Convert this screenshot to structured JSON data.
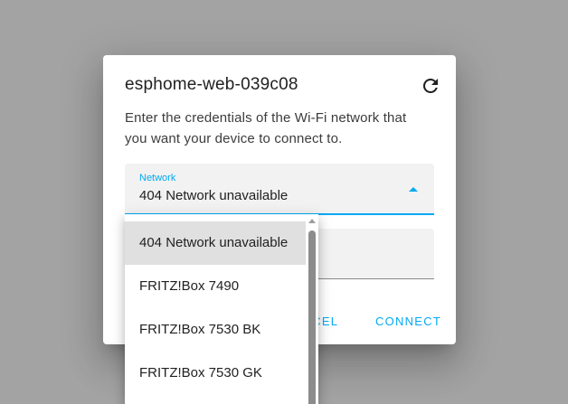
{
  "dialog": {
    "title": "esphome-web-039c08",
    "refresh_icon": "refresh-icon",
    "description": "Enter the credentials of the Wi-Fi network that you want your device to connect to.",
    "network_field": {
      "label": "Network",
      "value": "404 Network unavailable",
      "icon": "arrow-up-icon"
    },
    "buttons": {
      "cancel": "CANCEL",
      "connect": "CONNECT"
    }
  },
  "dropdown": {
    "options": [
      "404 Network unavailable",
      "FRITZ!Box 7490",
      "FRITZ!Box 7530 BK",
      "FRITZ!Box 7530 GK"
    ],
    "selected_index": 0
  },
  "colors": {
    "accent": "#03a9f4",
    "scrim": "#a3a3a3"
  }
}
